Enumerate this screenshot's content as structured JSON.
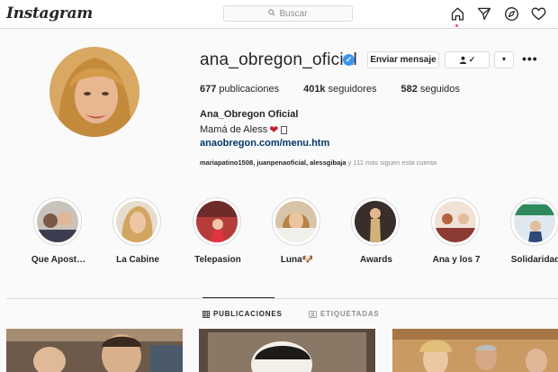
{
  "nav": {
    "logo": "Instagram",
    "search_placeholder": "Buscar",
    "icons": [
      "home-icon",
      "direct-icon",
      "explore-icon",
      "activity-heart-icon"
    ]
  },
  "profile": {
    "username": "ana_obregon_oficial",
    "verified": true,
    "message_button": "Enviar mensaje",
    "follow_button_icon": "person-check-icon",
    "posts_count": "677",
    "posts_label": "publicaciones",
    "followers_count": "401k",
    "followers_label": "seguidores",
    "following_count": "582",
    "following_label": "seguidos",
    "full_name": "Ana_Obregon Oficial",
    "bio": "Mamá de Aless",
    "website": "anaobregon.com/menu.htm",
    "followed_by_users": "mariapatino1508, juanpenaoficial, alessgibaja",
    "followed_by_suffix": " y 111 más siguen esta cuenta"
  },
  "highlights": [
    {
      "label": "Que Apost…"
    },
    {
      "label": "La Cabine"
    },
    {
      "label": "Telepasion"
    },
    {
      "label": "Luna🐶"
    },
    {
      "label": "Awards"
    },
    {
      "label": "Ana y los 7"
    },
    {
      "label": "Solidaridad"
    }
  ],
  "tabs": {
    "publicaciones": "PUBLICACIONES",
    "etiquetadas": "ETIQUETADAS"
  },
  "colors": {
    "link": "#00376b",
    "verified": "#3897f0",
    "border": "#dbdbdb"
  }
}
